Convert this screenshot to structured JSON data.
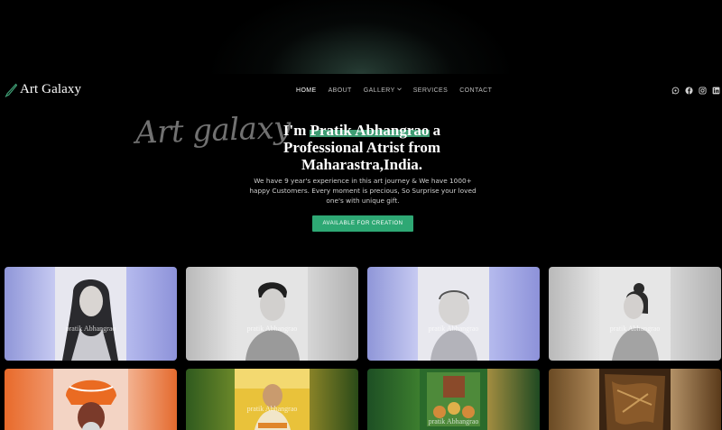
{
  "brand": {
    "name": "Art Galaxy",
    "icon": "brush-icon"
  },
  "nav": {
    "items": [
      {
        "label": "HOME",
        "active": true
      },
      {
        "label": "ABOUT"
      },
      {
        "label": "GALLERY",
        "dropdown": true
      },
      {
        "label": "SERVICES"
      },
      {
        "label": "CONTACT"
      }
    ]
  },
  "socials": [
    "whatsapp-icon",
    "facebook-icon",
    "instagram-icon",
    "linkedin-icon"
  ],
  "hero": {
    "script": "Art galaxy",
    "title_pre": "I'm ",
    "title_name": "Pratik Abhangrao",
    "title_post": " a Professional Atrist from Maharastra,India.",
    "description": "We have 9 year's experience in this art journey & We have 1000+ happy Customers. Every moment is precious, So Surprise your loved one's with unique gift.",
    "cta": "AVAILABLE FOR CREATION"
  },
  "gallery": {
    "watermark": "pratik Abhangrao",
    "items": [
      {
        "style": "pencil portrait, woman"
      },
      {
        "style": "pencil portrait, man"
      },
      {
        "style": "pencil portrait, child"
      },
      {
        "style": "pencil portrait, woman profile"
      },
      {
        "style": "color painting, saffron turban"
      },
      {
        "style": "color painting, saint"
      },
      {
        "style": "color painting, group"
      },
      {
        "style": "color painting, brown texture"
      }
    ]
  },
  "colors": {
    "accent": "#2ea874",
    "highlight": "#3e9c73",
    "background": "#000000"
  }
}
